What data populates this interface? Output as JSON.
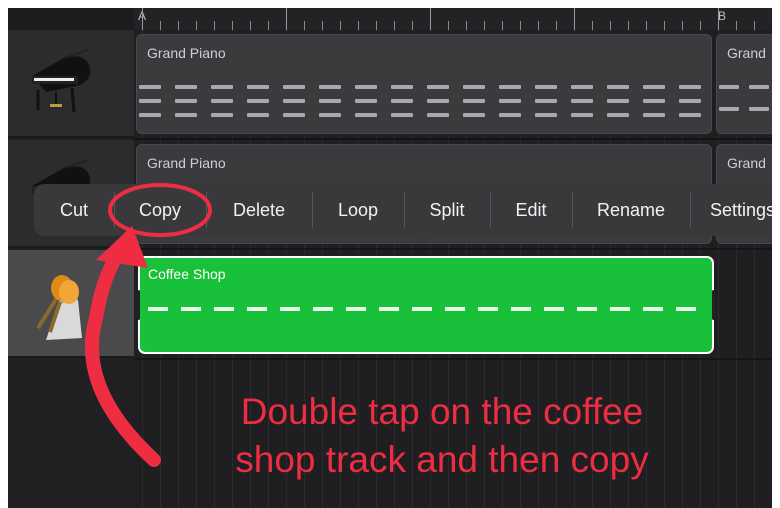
{
  "ruler": {
    "markers": [
      "A",
      "B"
    ]
  },
  "tracks": [
    {
      "icon": "grand-piano-icon"
    },
    {
      "icon": "grand-piano-icon"
    },
    {
      "icon": "maracas-shaker-icon"
    }
  ],
  "regions": {
    "piano1": "Grand Piano",
    "piano1_b": "Grand",
    "piano2": "Grand Piano",
    "piano2_b": "Grand",
    "coffee": "Coffee Shop"
  },
  "context_menu": {
    "items": [
      "Cut",
      "Copy",
      "Delete",
      "Loop",
      "Split",
      "Edit",
      "Rename",
      "Settings"
    ]
  },
  "annotation": {
    "line1": "Double tap on the coffee",
    "line2": "shop track and then copy",
    "color": "#ee2d43"
  },
  "colors": {
    "region_green": "#19c13a",
    "menu_bg": "#39393c"
  }
}
